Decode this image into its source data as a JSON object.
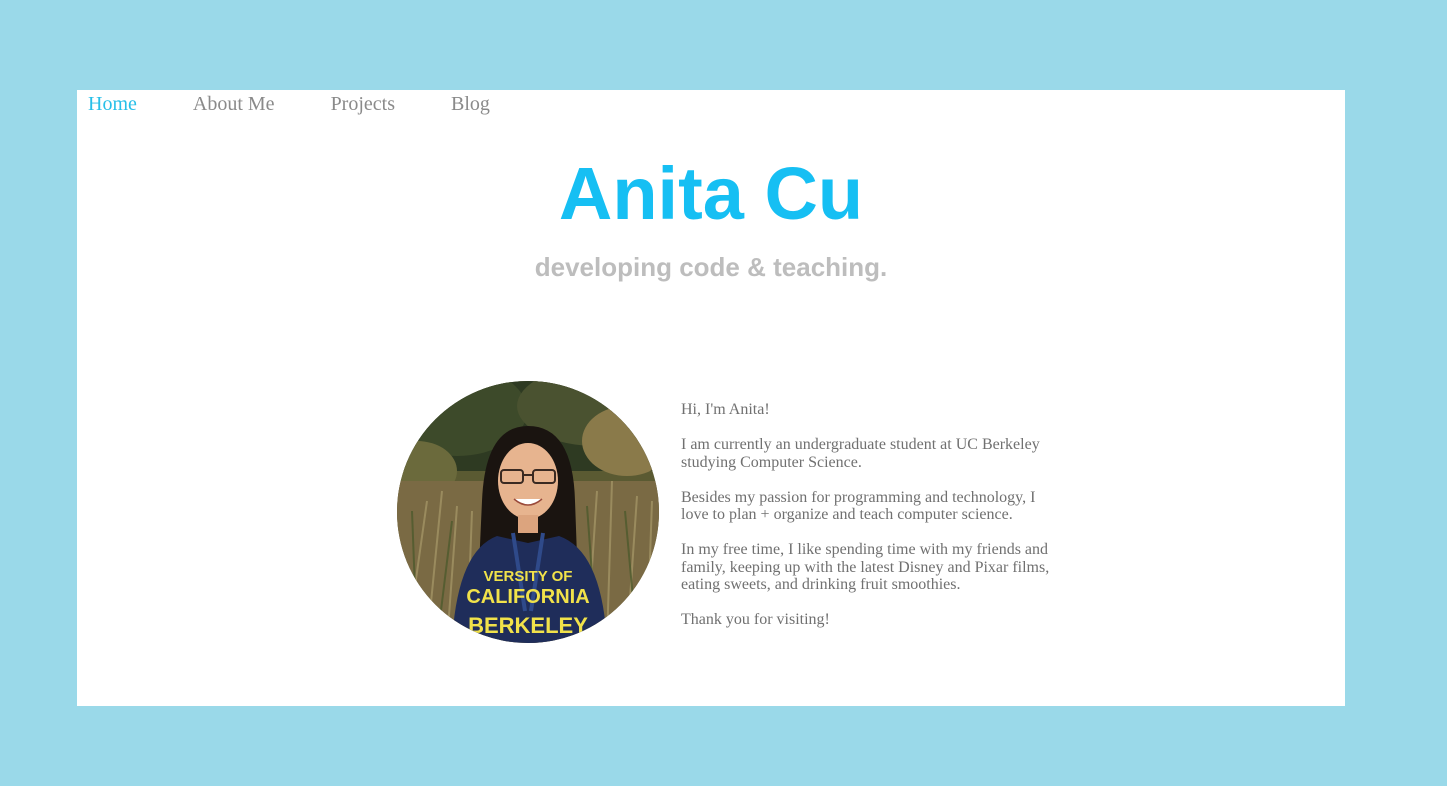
{
  "nav": {
    "items": [
      {
        "label": "Home",
        "active": true
      },
      {
        "label": "About Me",
        "active": false
      },
      {
        "label": "Projects",
        "active": false
      },
      {
        "label": "Blog",
        "active": false
      }
    ]
  },
  "hero": {
    "title": "Anita Cu",
    "subtitle": "developing code & teaching."
  },
  "profile": {
    "photo": "profile-photo",
    "shirt_text_line1": "VERSITY OF",
    "shirt_text_line2": "CALIFORNIA",
    "shirt_text_line3": "BERKELEY"
  },
  "bio": {
    "greeting": "Hi, I'm Anita!",
    "paragraph1": "I am currently an undergraduate student at UC Berkeley studying Computer Science.",
    "paragraph2": "Besides my passion for programming and technology, I love to plan + organize and teach computer science.",
    "paragraph3": "In my free time, I like spending time with my friends and family, keeping up with the latest Disney and Pixar films, eating sweets, and drinking fruit smoothies.",
    "closing": "Thank you for visiting!"
  },
  "colors": {
    "background": "#9ad9e9",
    "accent": "#16bff3",
    "nav_active": "#27bfe8",
    "muted": "#bdbdbd"
  }
}
